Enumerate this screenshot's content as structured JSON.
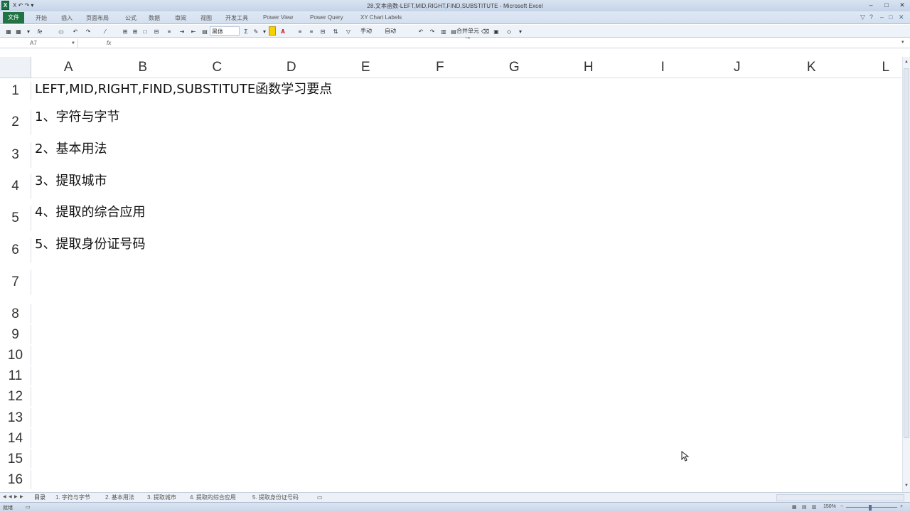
{
  "window": {
    "title": "28.文本函数-LEFT,MID,RIGHT,FIND,SUBSTITUTE - Microsoft Excel",
    "quick_access": "X ↶ ↷ ▾",
    "app_icon": "excel-icon",
    "controls": [
      "–",
      "□",
      "✕"
    ]
  },
  "ribbon": {
    "file_tab": "文件",
    "tabs": [
      "开始",
      "插入",
      "页面布局",
      "公式",
      "数据",
      "审阅",
      "视图",
      "开发工具",
      "Power View",
      "Power Query",
      "XY Chart Labels"
    ],
    "right_icons": [
      "▽",
      "?",
      "–",
      "□",
      "✕"
    ]
  },
  "toolbar": {
    "font_name": "黑体",
    "sum_symbol": "Σ",
    "font_color_label": "A",
    "wrap_label": "手动",
    "auto_label": "自动",
    "merge_label": "合并单元格"
  },
  "formula_bar": {
    "name_box": "A7",
    "fx": "fx",
    "value": ""
  },
  "columns": [
    "A",
    "B",
    "C",
    "D",
    "E",
    "F",
    "G",
    "H",
    "I",
    "J",
    "K",
    "L"
  ],
  "rows": [
    "1",
    "2",
    "3",
    "4",
    "5",
    "6",
    "7",
    "8",
    "9",
    "10",
    "11",
    "12",
    "13",
    "14",
    "15",
    "16"
  ],
  "cells": {
    "A1": "LEFT,MID,RIGHT,FIND,SUBSTITUTE函数学习要点",
    "A2": "1、字符与字节",
    "A3": "2、基本用法",
    "A4": "3、提取城市",
    "A5": "4、提取的综合应用",
    "A6": "5、提取身份证号码"
  },
  "sheet_tabs": [
    "目录",
    "1. 字符与字节",
    "2. 基本用法",
    "3. 提取城市",
    "4. 提取的综合应用",
    "5. 提取身份证号码"
  ],
  "status": {
    "ready": "就绪",
    "zoom": "150%"
  },
  "colors": {
    "file_tab": "#217346",
    "grid_bg": "#ffffff",
    "ribbon_bg": "#dfe8f4"
  }
}
